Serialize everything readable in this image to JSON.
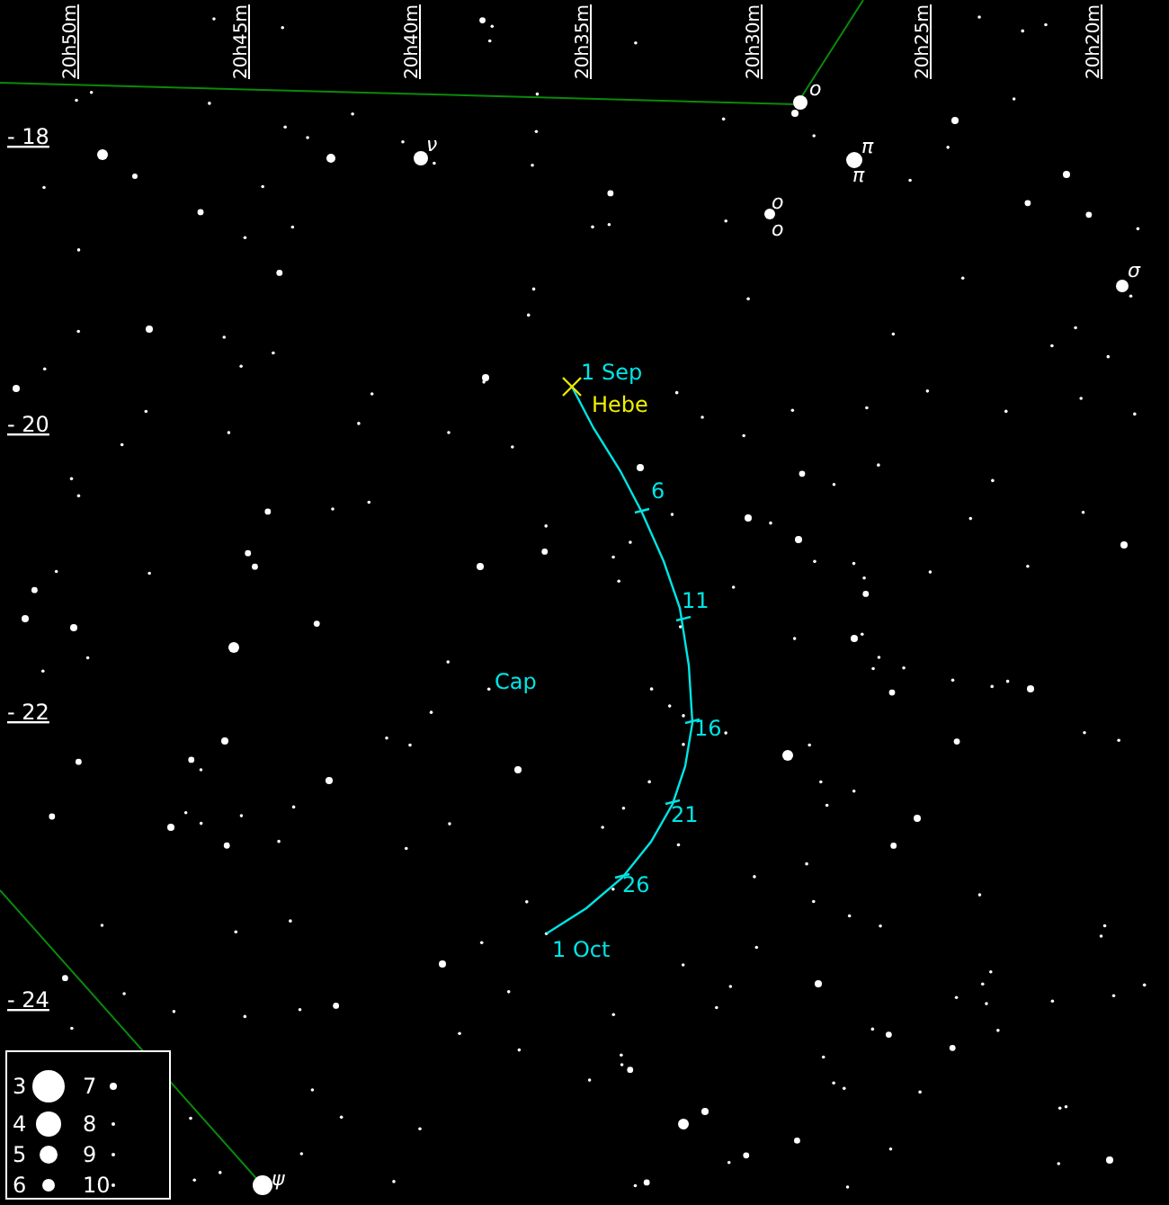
{
  "ra_labels": [
    "20h50m",
    "20h45m",
    "20h40m",
    "20h35m",
    "20h30m",
    "20h25m",
    "20h20m"
  ],
  "dec_labels": [
    "- 18",
    "- 20",
    "- 22",
    "- 24"
  ],
  "star_labels": [
    {
      "text": "ο"
    },
    {
      "text": "ν"
    },
    {
      "text": "π"
    },
    {
      "text": "π"
    },
    {
      "text": "ο"
    },
    {
      "text": "ο"
    },
    {
      "text": "σ"
    },
    {
      "text": "ψ"
    }
  ],
  "constellation": "Cap",
  "track": {
    "object": "Hebe",
    "start": "1 Sep",
    "ticks": [
      "6",
      "11",
      "16",
      "21",
      "26"
    ],
    "end": "1 Oct"
  },
  "legend": {
    "magnitudes": [
      "3",
      "4",
      "5",
      "6",
      "7",
      "8",
      "9",
      "10"
    ]
  }
}
